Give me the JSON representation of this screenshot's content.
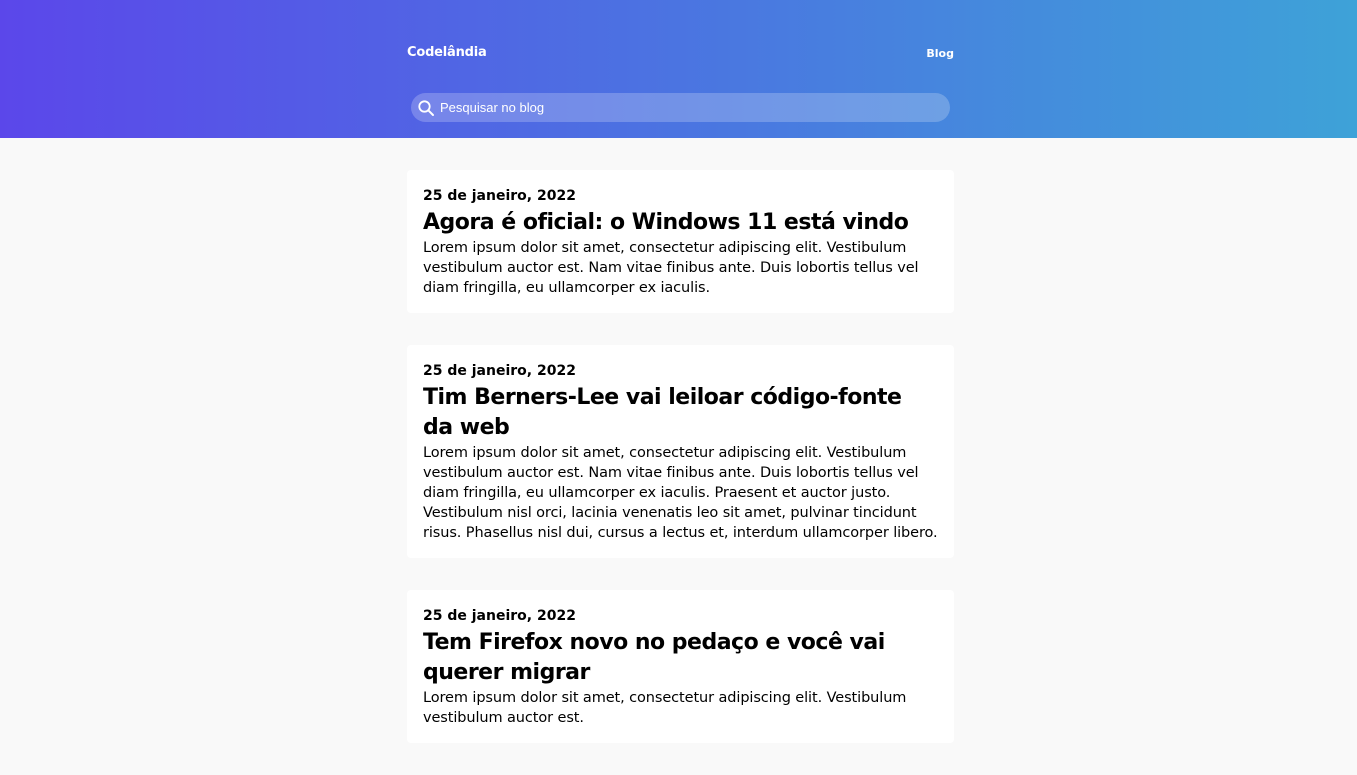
{
  "header": {
    "logo": "Codelândia",
    "nav_blog": "Blog",
    "search_placeholder": "Pesquisar no blog",
    "search_icon": "search-icon"
  },
  "colors": {
    "gradient_start": "#5b47ea",
    "gradient_end": "#3ea2d8",
    "page_background": "#f9f9f9",
    "card_background": "#ffffff"
  },
  "posts": [
    {
      "date": "25 de janeiro, 2022",
      "title": "Agora é oficial: o Windows 11 está vindo",
      "body": "Lorem ipsum dolor sit amet, consectetur adipiscing elit. Vestibulum vestibulum auctor est. Nam vitae finibus ante. Duis lobortis tellus vel diam fringilla, eu ullamcorper ex iaculis."
    },
    {
      "date": "25 de janeiro, 2022",
      "title": "Tim Berners-Lee vai leiloar código-fonte da web",
      "body": "Lorem ipsum dolor sit amet, consectetur adipiscing elit. Vestibulum vestibulum auctor est. Nam vitae finibus ante. Duis lobortis tellus vel diam fringilla, eu ullamcorper ex iaculis. Praesent et auctor justo. Vestibulum nisl orci, lacinia venenatis leo sit amet, pulvinar tincidunt risus. Phasellus nisl dui, cursus a lectus et, interdum ullamcorper libero."
    },
    {
      "date": "25 de janeiro, 2022",
      "title": "Tem Firefox novo no pedaço e você vai querer migrar",
      "body": "Lorem ipsum dolor sit amet, consectetur adipiscing elit. Vestibulum vestibulum auctor est."
    }
  ]
}
